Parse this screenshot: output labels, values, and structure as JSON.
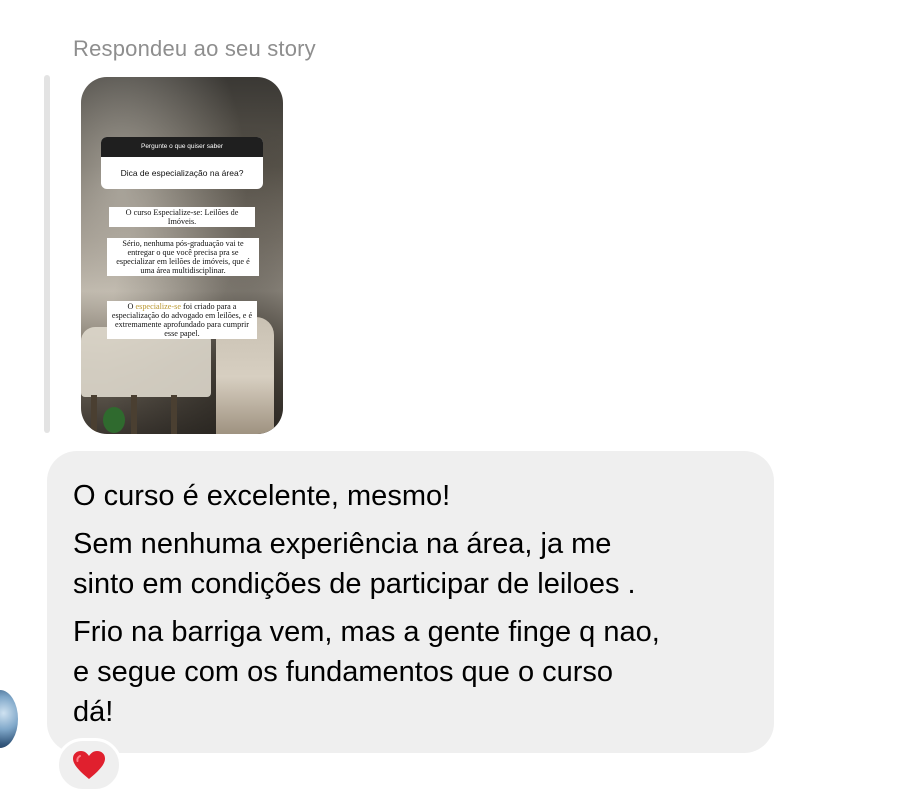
{
  "reply_header": "Respondeu ao seu story",
  "story": {
    "question_box": {
      "header": "Pergunte o que quiser saber",
      "question": "Dica de especialização na área?"
    },
    "captions": {
      "c1": "O curso Especialize-se: Leilões de Imóveis.",
      "c2": "Sério, nenhuma pós-graduação vai te entregar o que você precisa pra se especializar em leilões de imóveis, que é uma área multidisciplinar.",
      "c3_before": "O ",
      "c3_accent": "especialize-se",
      "c3_after": " foi criado para a especialização do advogado em leilões, e é extremamente aprofundado para cumprir esse papel."
    }
  },
  "message": {
    "lines": [
      "O curso é excelente, mesmo!",
      "Sem nenhuma experiência na área, ja me",
      "sinto em condições de participar de leiloes .",
      "Frio na barriga vem, mas a gente finge q nao,",
      "e segue com os fundamentos que o curso",
      "dá!"
    ]
  },
  "reaction": {
    "icon": "red-heart-icon",
    "color": "#e0202e"
  },
  "colors": {
    "bubble": "#efefef",
    "header_text": "#8e8e8e"
  }
}
